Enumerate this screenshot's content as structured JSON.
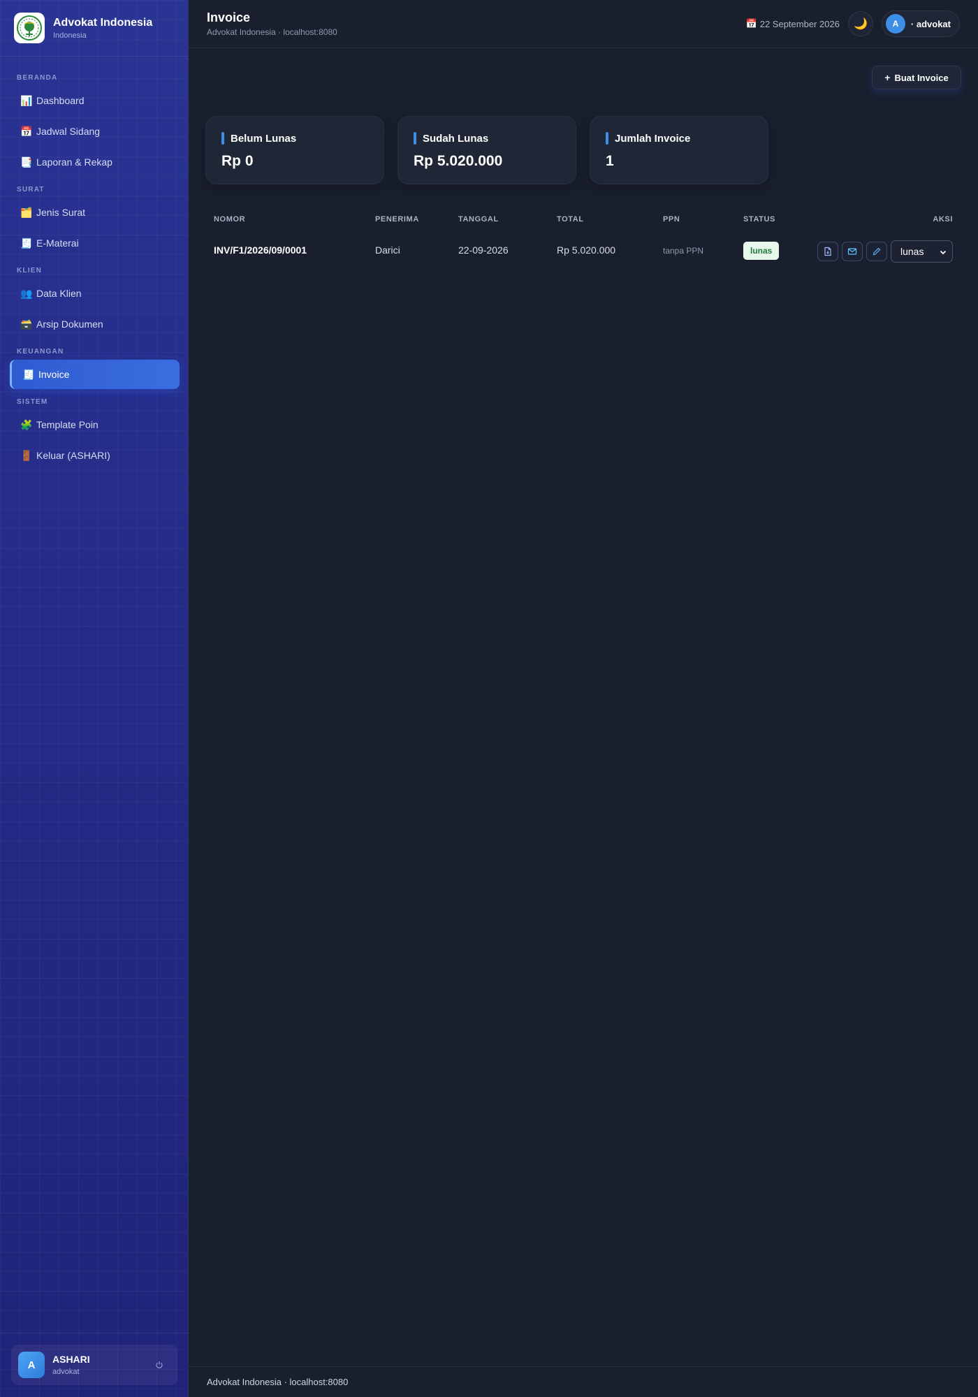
{
  "brand": {
    "title": "Advokat Indonesia",
    "subtitle": "Indonesia"
  },
  "nav": {
    "sections": [
      {
        "label": "BERANDA"
      },
      {
        "label": "SURAT"
      },
      {
        "label": "KLIEN"
      },
      {
        "label": "KEUANGAN"
      },
      {
        "label": "SISTEM"
      }
    ],
    "items": [
      {
        "icon": "📊",
        "icon_name": "chart-icon",
        "label": "Dashboard"
      },
      {
        "icon": "📅",
        "icon_name": "calendar-icon",
        "label": "Jadwal Sidang"
      },
      {
        "icon": "📑",
        "icon_name": "report-icon",
        "label": "Laporan & Rekap"
      },
      {
        "icon": "🗂️",
        "icon_name": "folder-icon",
        "label": "Jenis Surat"
      },
      {
        "icon": "🧾",
        "icon_name": "receipt-icon",
        "label": "E-Materai"
      },
      {
        "icon": "👥",
        "icon_name": "users-icon",
        "label": "Data Klien"
      },
      {
        "icon": "🗃️",
        "icon_name": "archive-icon",
        "label": "Arsip Dokumen"
      },
      {
        "icon": "🧾",
        "icon_name": "invoice-icon",
        "label": "Invoice",
        "active": true
      },
      {
        "icon": "🧩",
        "icon_name": "puzzle-icon",
        "label": "Template Poin"
      },
      {
        "icon": "🚪",
        "icon_name": "door-icon",
        "label": "Keluar (ASHARI)"
      }
    ]
  },
  "sidebar_user": {
    "initial": "A",
    "name": "ASHARI",
    "role": "advokat"
  },
  "header": {
    "title": "Invoice",
    "subtitle": "Advokat Indonesia · localhost:8080",
    "date_icon": "📅",
    "date": "22 September 2026",
    "theme_icon": "🌙",
    "user_initial": "A",
    "user_label": "· advokat"
  },
  "create_button": {
    "icon": "+",
    "label": "Buat Invoice"
  },
  "stats": [
    {
      "label": "Belum Lunas",
      "value": "Rp 0"
    },
    {
      "label": "Sudah Lunas",
      "value": "Rp 5.020.000"
    },
    {
      "label": "Jumlah Invoice",
      "value": "1"
    }
  ],
  "table": {
    "columns": [
      "NOMOR",
      "PENERIMA",
      "TANGGAL",
      "TOTAL",
      "PPN",
      "STATUS",
      "AKSI"
    ],
    "rows": [
      {
        "nomor": "INV/F1/2026/09/0001",
        "penerima": "Darici",
        "tanggal": "22-09-2026",
        "total": "Rp 5.020.000",
        "ppn": "tanpa PPN",
        "status": "lunas",
        "select_value": "lunas"
      }
    ]
  },
  "footer": {
    "text": "Advokat Indonesia · localhost:8080"
  },
  "colors": {
    "accent": "#3d8fe6",
    "sidebar": "#232b84",
    "background": "#1a1f2e",
    "status_paid_bg": "#e8f7ec",
    "status_paid_text": "#1e7c3a"
  }
}
